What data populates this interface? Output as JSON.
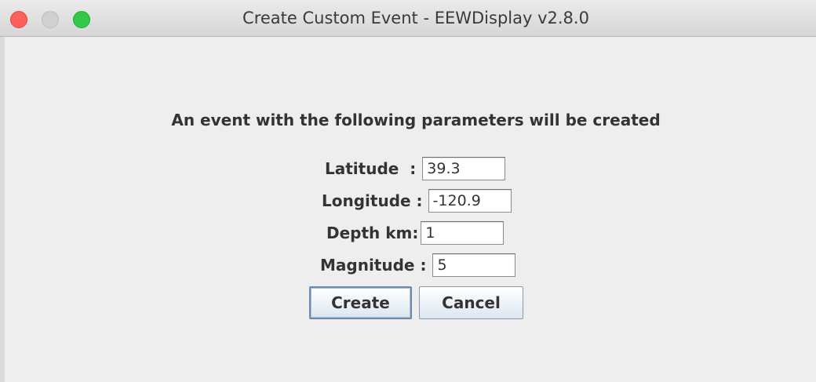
{
  "window": {
    "title": "Create Custom Event - EEWDisplay v2.8.0",
    "controls": [
      "close-icon",
      "minimize-icon",
      "maximize-icon"
    ]
  },
  "dialog": {
    "heading": "An event with the following parameters will be created",
    "fields": {
      "latitude": {
        "label": "Latitude  :",
        "value": "39.3"
      },
      "longitude": {
        "label": "Longitude :",
        "value": "-120.9"
      },
      "depth": {
        "label": "Depth km:",
        "value": "1"
      },
      "magnitude": {
        "label": "Magnitude :",
        "value": "5"
      }
    },
    "buttons": {
      "create": "Create",
      "cancel": "Cancel"
    }
  },
  "colors": {
    "close": "#fc605c",
    "minimize": "#d0d0d0",
    "maximize": "#34c84a",
    "background": "#eeeeee"
  }
}
